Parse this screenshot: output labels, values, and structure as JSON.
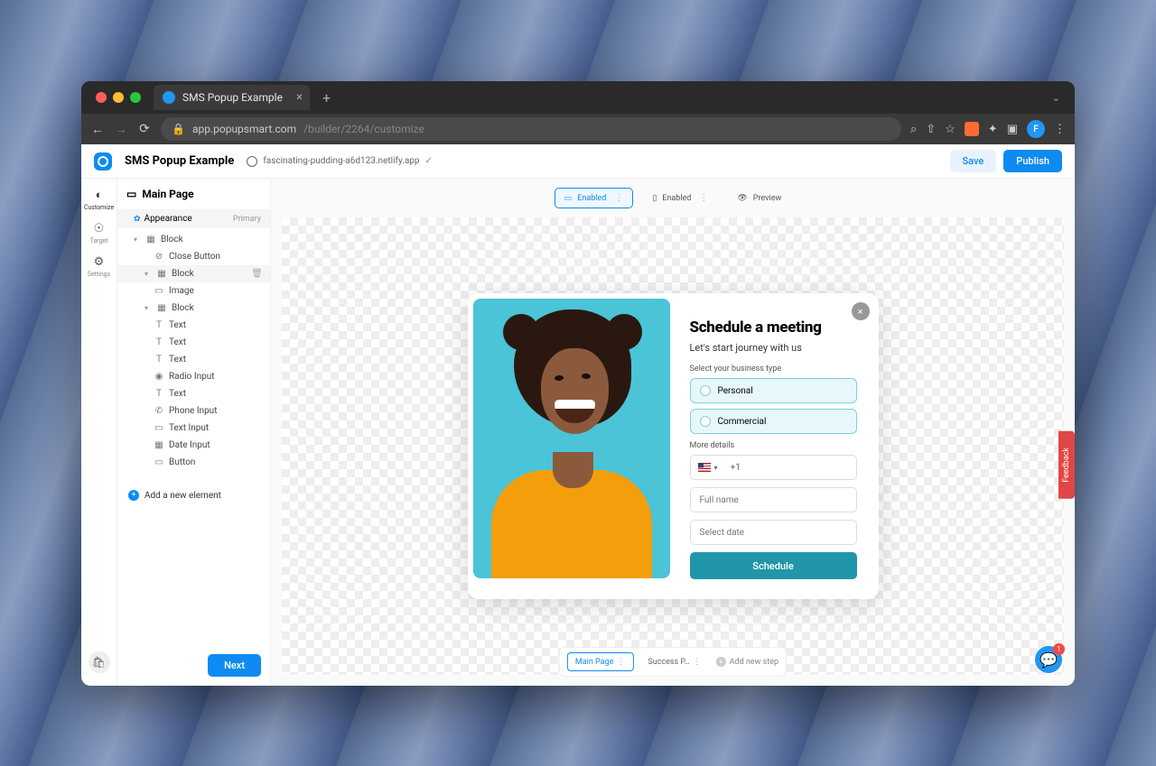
{
  "tab": {
    "title": "SMS Popup Example"
  },
  "url": {
    "base": "app.popupsmart.com",
    "path": "/builder/2264/customize"
  },
  "header": {
    "title": "SMS Popup Example",
    "domain": "fascinating-pudding-a6d123.netlify.app",
    "save": "Save",
    "publish": "Publish"
  },
  "rail": {
    "customize": "Customize",
    "target": "Target",
    "settings": "Settings"
  },
  "sidebar": {
    "title": "Main Page",
    "appearance": "Appearance",
    "appearanceBadge": "Primary",
    "tree": {
      "block1": "Block",
      "closeBtn": "Close Button",
      "block2": "Block",
      "image": "Image",
      "block3": "Block",
      "text1": "Text",
      "text2": "Text",
      "text3": "Text",
      "radio": "Radio Input",
      "text4": "Text",
      "phone": "Phone Input",
      "textInput": "Text Input",
      "date": "Date Input",
      "button": "Button"
    },
    "addElement": "Add a new element",
    "next": "Next"
  },
  "toolbar": {
    "desktop": "Enabled",
    "mobile": "Enabled",
    "preview": "Preview"
  },
  "popup": {
    "heading": "Schedule a meeting",
    "subtitle": "Let's start journey with us",
    "businessLabel": "Select your business type",
    "personal": "Personal",
    "commercial": "Commercial",
    "moreDetails": "More details",
    "phonePrefix": "+1",
    "fullname": "Full name",
    "selectDate": "Select date",
    "schedule": "Schedule"
  },
  "steps": {
    "main": "Main Page",
    "success": "Success P…",
    "add": "Add new step"
  },
  "feedback": "Feedback",
  "chat": {
    "badge": "1"
  },
  "avatar": "F"
}
